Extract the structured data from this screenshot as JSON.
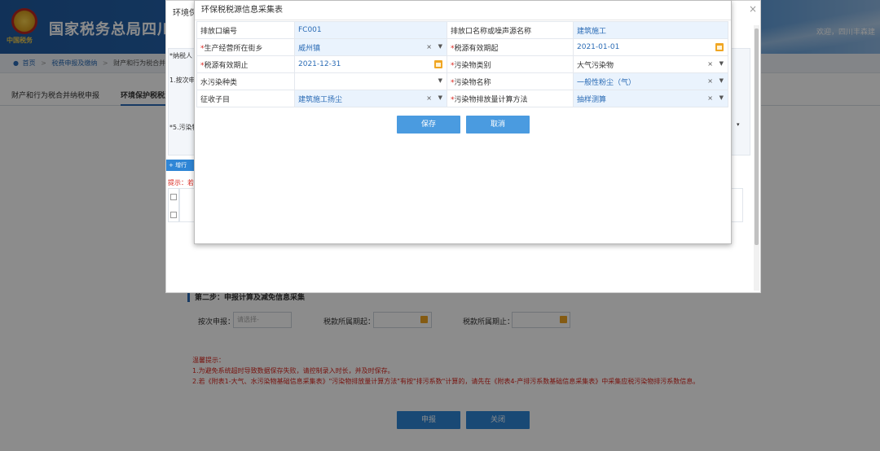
{
  "header": {
    "title": "国家税务总局四川",
    "emblem_text": "中国税务",
    "welcome": "欢迎，四川丰森建"
  },
  "breadcrumb": {
    "home": "首页",
    "item1": "税费申报及缴纳",
    "item2": "财产和行为税合并纳"
  },
  "main_tabs": {
    "tab1": "财产和行为税合并纳税申报",
    "tab2": "环境保护税税源"
  },
  "step2": {
    "title": "第二步：申报计算及减免信息采集",
    "report_label": "按次申报：",
    "report_placeholder": "请选择-",
    "period_start_label": "税款所属期起：",
    "period_end_label": "税款所属期止："
  },
  "tips": {
    "title": "温馨提示：",
    "line1": "1.为避免系统超时导致数据保存失败，请控制录入时长，并及时保存。",
    "line2": "2.若《附表1-大气、水污染物基础信息采集表》\"污染物排放量计算方法\"有按\"排污系数\"计算的，请先在《附表4-产排污系数基础信息采集表》中采集应税污染物排污系数信息。"
  },
  "bottom_buttons": {
    "declare": "申报",
    "close": "关闭"
  },
  "outer_dialog": {
    "title": "环境保",
    "close": "×",
    "label_taxpayer": "*纳税人",
    "label_once": "1.按次申",
    "label_pollutant": "*5.污染物",
    "add_row": "+ 增行",
    "hint": "提示：若"
  },
  "inner_dialog": {
    "title": "环保税税源信息采集表",
    "save": "保存",
    "cancel": "取消",
    "rows": [
      {
        "l1": "排放口编号",
        "l1_req": "",
        "v1": "FC001",
        "l2": "排放口名称或噪声源名称",
        "l2_req": "",
        "v2": "建筑施工"
      },
      {
        "l1": "生产经营所在街乡",
        "l1_req": "*",
        "v1": "威州镇",
        "l2": "税源有效期起",
        "l2_req": "*",
        "v2": "2021-01-01"
      },
      {
        "l1": "税源有效期止",
        "l1_req": "*",
        "v1": "2021-12-31",
        "l2": "污染物类别",
        "l2_req": "*",
        "v2": "大气污染物"
      },
      {
        "l1": "水污染种类",
        "l1_req": "",
        "v1": "",
        "l2": "污染物名称",
        "l2_req": "*",
        "v2": "一般性粉尘（气）"
      },
      {
        "l1": "征收子目",
        "l1_req": "",
        "v1": "建筑施工扬尘",
        "l2": "污染物排放量计算方法",
        "l2_req": "*",
        "v2": "抽样测算"
      }
    ]
  },
  "colors": {
    "accent": "#2a6bb5",
    "button": "#4a9be0",
    "warning": "#d9251d",
    "calendar": "#f0a623"
  }
}
